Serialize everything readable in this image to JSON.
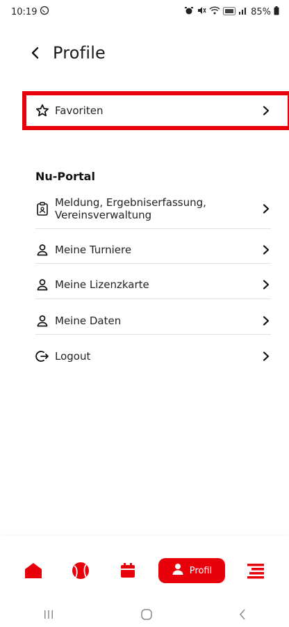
{
  "status": {
    "time": "10:19",
    "battery": "85%"
  },
  "header": {
    "title": "Profile"
  },
  "favorites": {
    "label": "Favoriten"
  },
  "section": {
    "title": "Nu-Portal"
  },
  "menu": [
    {
      "label_line1": "Meldung, Ergebniserfassung,",
      "label_line2": "Vereinsverwaltung",
      "icon": "clipboard-user-icon"
    },
    {
      "label": "Meine Turniere",
      "icon": "user-icon"
    },
    {
      "label": "Meine Lizenzkarte",
      "icon": "user-icon"
    },
    {
      "label": "Meine Daten",
      "icon": "user-icon"
    },
    {
      "label": "Logout",
      "icon": "logout-icon"
    }
  ],
  "bottom_nav": {
    "home": "home-icon",
    "ball": "ball-icon",
    "calendar": "calendar-icon",
    "active_label": "Profil",
    "menu": "menu-icon"
  },
  "colors": {
    "accent": "#e8000b"
  }
}
